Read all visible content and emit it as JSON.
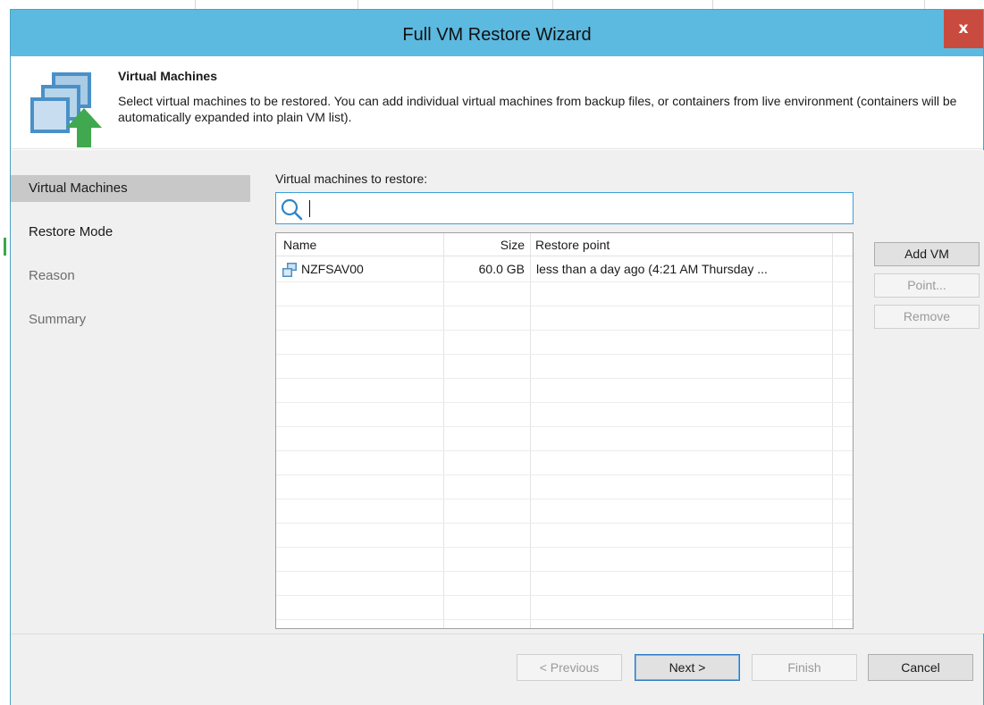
{
  "window": {
    "title": "Full VM Restore Wizard",
    "close_label": "x"
  },
  "header": {
    "title": "Virtual Machines",
    "description": "Select virtual machines to be restored. You can add individual virtual machines from backup files, or containers from live environment (containers will be automatically expanded into plain VM list)."
  },
  "sidebar": {
    "items": [
      {
        "label": "Virtual Machines",
        "state": "active"
      },
      {
        "label": "Restore Mode",
        "state": "enabled"
      },
      {
        "label": "Reason",
        "state": "disabled"
      },
      {
        "label": "Summary",
        "state": "disabled"
      }
    ]
  },
  "main": {
    "list_label": "Virtual machines to restore:",
    "search": {
      "value": "",
      "placeholder": ""
    },
    "columns": [
      "Name",
      "Size",
      "Restore point"
    ],
    "rows": [
      {
        "name": "NZFSAV00",
        "size": "60.0 GB",
        "restore_point": "less than a day ago (4:21 AM Thursday ..."
      }
    ],
    "buttons": {
      "add_vm": "Add VM",
      "point": "Point...",
      "remove": "Remove"
    }
  },
  "footer": {
    "previous": "< Previous",
    "next": "Next >",
    "finish": "Finish",
    "cancel": "Cancel"
  },
  "colors": {
    "titlebar": "#5cb9df",
    "close": "#c94b3f",
    "accent_green": "#3aa84a",
    "search_border": "#3ea0d8"
  }
}
